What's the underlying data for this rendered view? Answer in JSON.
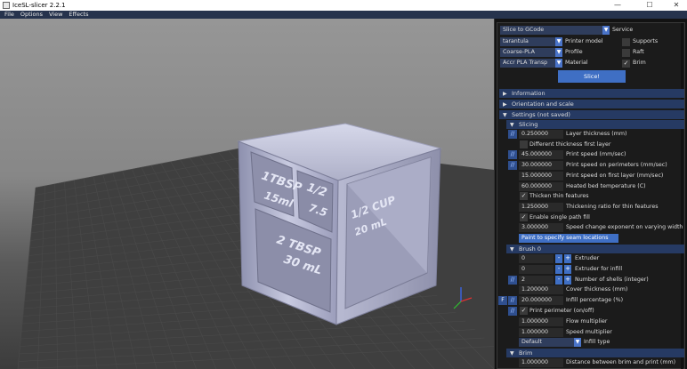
{
  "window": {
    "title": "IceSL-slicer 2.2.1",
    "minimize": "—",
    "maximize": "☐",
    "close": "✕"
  },
  "menu": [
    "File",
    "Options",
    "View",
    "Effects"
  ],
  "model": {
    "labels": [
      "1TBSP",
      "15ml",
      "1/2",
      "7.5",
      "2 TBSP",
      "30 mL",
      "1/2 CUP",
      "20 mL"
    ]
  },
  "panel": {
    "top": {
      "slice_mode": "Slice to GCode",
      "service_label": "Service",
      "printer": "tarantula",
      "printer_label": "Printer model",
      "profile": "Coarse-PLA",
      "profile_label": "Profile",
      "material": "Accr PLA Transp",
      "material_label": "Material",
      "supports_label": "Supports",
      "raft_label": "Raft",
      "brim_label": "Brim",
      "brim_checked": true,
      "slice_button": "Slice!"
    },
    "sections": {
      "information": "Information",
      "orientation": "Orientation and scale",
      "settings": "Settings (not saved)",
      "slicing": "Slicing",
      "brush": "Brush 0",
      "brim": "Brim"
    },
    "slicing_rows": [
      {
        "slash": "//",
        "value": "0.250000",
        "label": "Layer thickness (mm)"
      },
      {
        "check": "",
        "label": "Different thickness first layer"
      },
      {
        "slash": "//",
        "value": "45.000000",
        "label": "Print speed (mm/sec)"
      },
      {
        "slash": "//",
        "value": "30.000000",
        "label": "Print speed on perimeters (mm/sec)"
      },
      {
        "value": "15.000000",
        "label": "Print speed on first layer (mm/sec)"
      },
      {
        "value": "60.000000",
        "label": "Heated bed temperature (C)"
      },
      {
        "check": "✓",
        "label": "Thicken thin features"
      },
      {
        "value": "1.250000",
        "label": "Thickening ratio for thin features"
      },
      {
        "check": "✓",
        "label": "Enable single path fill"
      },
      {
        "value": "3.000000",
        "label": "Speed change exponent on varying width"
      }
    ],
    "paint_button": "Paint to specify seam locations",
    "brush_rows": [
      {
        "value": "0",
        "minus": "-",
        "plus": "+",
        "label": "Extruder"
      },
      {
        "value": "0",
        "minus": "-",
        "plus": "+",
        "label": "Extruder for infill"
      },
      {
        "slash": "//",
        "value": "2",
        "minus": "-",
        "plus": "+",
        "label": "Number of shells (integer)"
      },
      {
        "value": "1.200000",
        "label": "Cover thickness (mm)"
      },
      {
        "fbtn": "F",
        "slash": "//",
        "value": "20.000000",
        "label": "Infill percentage (%)"
      },
      {
        "slash": "//",
        "check": "✓",
        "label": "Print perimeter (on/off)"
      },
      {
        "value": "1.000000",
        "label": "Flow multiplier"
      },
      {
        "value": "1.000000",
        "label": "Speed multiplier"
      },
      {
        "combo": "Default",
        "label": "Infill type"
      }
    ],
    "brim_rows": [
      {
        "value": "1.000000",
        "label": "Distance between brim and print (mm)"
      }
    ],
    "tri_right": "▶",
    "tri_down": "▼",
    "arrow": "▼"
  }
}
